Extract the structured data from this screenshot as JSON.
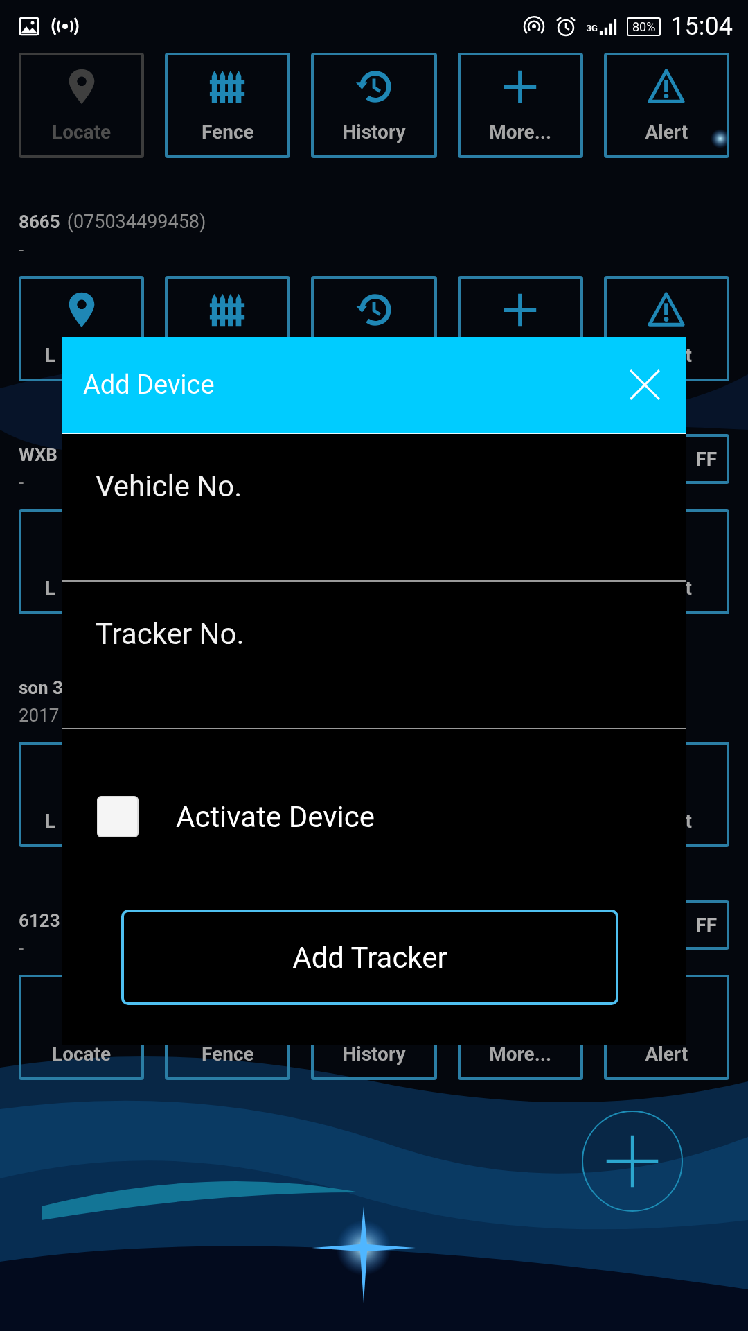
{
  "status_bar": {
    "network": "3G",
    "battery": "80%",
    "time": "15:04"
  },
  "devices": [
    {
      "actions": [
        {
          "label": "Locate",
          "disabled": true,
          "kind": "full"
        },
        {
          "label": "Fence",
          "disabled": false,
          "kind": "full"
        },
        {
          "label": "History",
          "disabled": false,
          "kind": "full"
        },
        {
          "label": "More...",
          "disabled": false,
          "kind": "full"
        },
        {
          "label": "Alert",
          "disabled": false,
          "kind": "full"
        }
      ]
    },
    {
      "name": "8665",
      "number": "(075034499458)",
      "detail": "-",
      "actions": [
        {
          "label": "L",
          "disabled": false,
          "kind": "start"
        },
        {
          "disabled": false,
          "kind": "icon"
        },
        {
          "disabled": false,
          "kind": "icon"
        },
        {
          "disabled": false,
          "kind": "icon"
        },
        {
          "label": "t",
          "disabled": false,
          "kind": "end"
        }
      ]
    },
    {
      "name": "WXB",
      "detail": "-",
      "toggle": "FF",
      "actions": [
        {
          "label": "L",
          "disabled": false,
          "kind": "edge-start"
        },
        {
          "kind": "covered"
        },
        {
          "kind": "covered"
        },
        {
          "kind": "covered"
        },
        {
          "label": "t",
          "disabled": false,
          "kind": "edge-end"
        }
      ]
    },
    {
      "name": "son 3",
      "detail": "2017",
      "actions": [
        {
          "label": "L",
          "disabled": false,
          "kind": "edge-start"
        },
        {
          "kind": "covered"
        },
        {
          "kind": "covered"
        },
        {
          "kind": "covered"
        },
        {
          "label": "t",
          "disabled": false,
          "kind": "edge-end"
        }
      ]
    },
    {
      "name": "6123",
      "detail": "-",
      "toggle": "FF",
      "actions": [
        {
          "label": "Locate",
          "disabled": false,
          "kind": "label"
        },
        {
          "label": "Fence",
          "disabled": false,
          "kind": "label"
        },
        {
          "label": "History",
          "disabled": false,
          "kind": "label"
        },
        {
          "label": "More...",
          "disabled": false,
          "kind": "label"
        },
        {
          "label": "Alert",
          "disabled": false,
          "kind": "label"
        }
      ]
    }
  ],
  "dialog": {
    "title": "Add Device",
    "fields": [
      {
        "placeholder": "Vehicle No."
      },
      {
        "placeholder": "Tracker No."
      }
    ],
    "checkbox": {
      "label": "Activate Device",
      "checked": false
    },
    "submit": "Add Tracker"
  }
}
